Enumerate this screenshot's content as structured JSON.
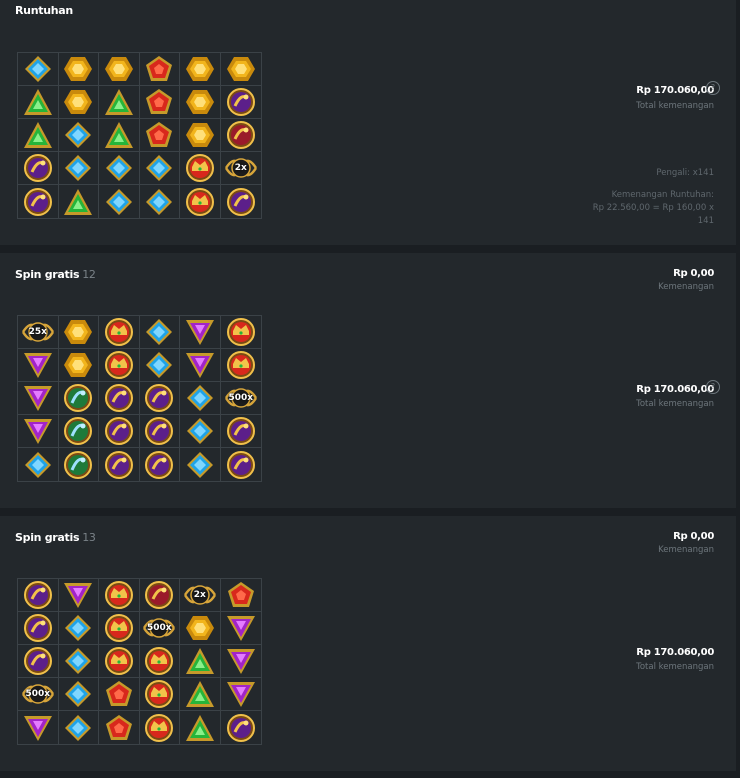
{
  "rounds": [
    {
      "title": "Runtuhan",
      "num": "",
      "top_amount": "",
      "top_label": "",
      "total_amount": "Rp 170.060,00",
      "total_label": "Total kemenangan",
      "multiplier_text": "Pengali: x141",
      "cascade_label": "Kemenangan Runtuhan:",
      "cascade_formula": "Rp 22.560,00 = Rp 160,00 x",
      "cascade_tail": "141",
      "grid": [
        [
          "diamond-blue",
          "hex-gold",
          "hex-gold",
          "pent-red",
          "hex-gold",
          "hex-gold"
        ],
        [
          "tri-green",
          "hex-gold",
          "tri-green",
          "pent-red",
          "hex-gold",
          "coin-purple"
        ],
        [
          "tri-green",
          "diamond-blue",
          "tri-green",
          "pent-red",
          "hex-gold",
          "coin-red"
        ],
        [
          "coin-purple",
          "diamond-blue",
          "diamond-blue",
          "diamond-blue",
          "crown-red",
          "mult-2"
        ],
        [
          "coin-purple",
          "tri-green",
          "diamond-blue",
          "diamond-blue",
          "crown-red",
          "coin-purple"
        ]
      ]
    },
    {
      "title": "Spin gratis",
      "num": "12",
      "top_amount": "Rp 0,00",
      "top_label": "Kemenangan",
      "total_amount": "Rp 170.060,00",
      "total_label": "Total kemenangan",
      "grid": [
        [
          "mult-25",
          "hex-gold",
          "crown-red",
          "diamond-blue",
          "tri-purple",
          "crown-red"
        ],
        [
          "tri-purple",
          "hex-gold",
          "crown-red",
          "diamond-blue",
          "tri-purple",
          "crown-red"
        ],
        [
          "tri-purple",
          "coin-green",
          "coin-purple",
          "coin-purple",
          "diamond-blue",
          "mult-500"
        ],
        [
          "tri-purple",
          "coin-green",
          "coin-purple",
          "coin-purple",
          "diamond-blue",
          "coin-purple"
        ],
        [
          "diamond-blue",
          "coin-green",
          "coin-purple",
          "coin-purple",
          "diamond-blue",
          "coin-purple"
        ]
      ]
    },
    {
      "title": "Spin gratis",
      "num": "13",
      "top_amount": "Rp 0,00",
      "top_label": "Kemenangan",
      "total_amount": "Rp 170.060,00",
      "total_label": "Total kemenangan",
      "grid": [
        [
          "coin-purple",
          "tri-purple",
          "crown-red",
          "coin-red",
          "mult-2",
          "pent-red"
        ],
        [
          "coin-purple",
          "diamond-blue",
          "crown-red",
          "mult-500",
          "hex-gold",
          "tri-purple"
        ],
        [
          "coin-purple",
          "diamond-blue",
          "crown-red",
          "crown-red",
          "tri-green",
          "tri-purple"
        ],
        [
          "mult-500",
          "diamond-blue",
          "pent-red",
          "crown-red",
          "tri-green",
          "tri-purple"
        ],
        [
          "tri-purple",
          "diamond-blue",
          "pent-red",
          "crown-red",
          "tri-green",
          "coin-purple"
        ]
      ]
    }
  ],
  "multipliers": {
    "mult-2": "2x",
    "mult-25": "25x",
    "mult-500": "500x"
  },
  "info_icon": "?",
  "colors": {
    "blue": "#1fa3e8",
    "gold": "#f2b51c",
    "red": "#d8281c",
    "green": "#26b53a",
    "purple": "#a223c8",
    "panel": "#23282c"
  }
}
